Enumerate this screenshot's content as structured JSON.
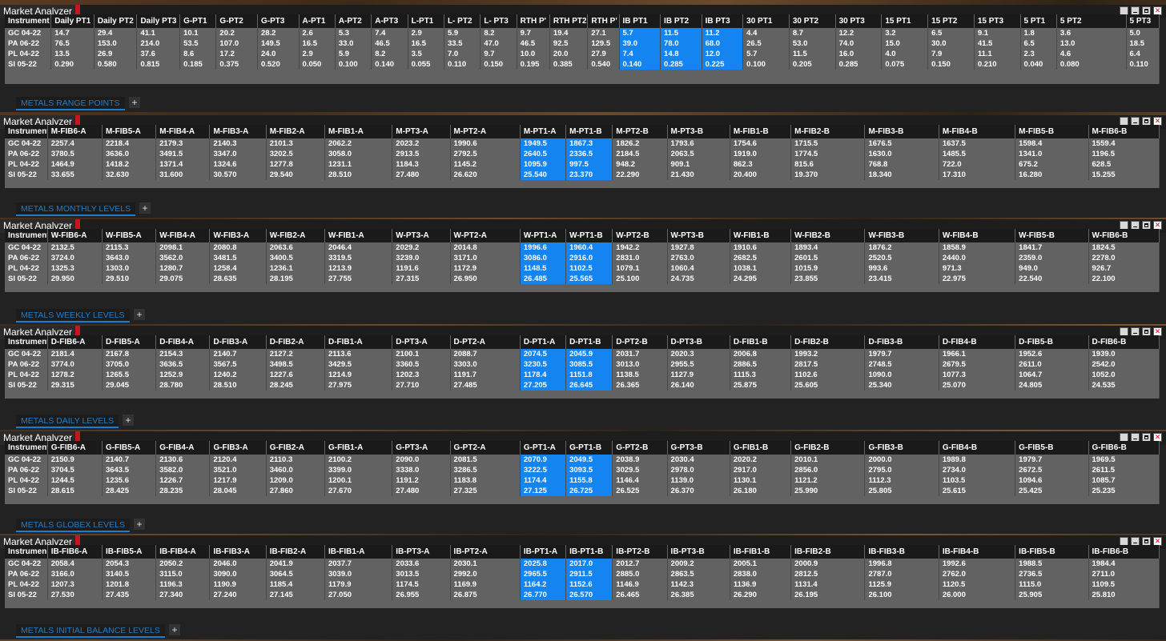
{
  "panels": [
    {
      "title": "Market Analyzer",
      "tab": "METALS RANGE POINTS",
      "columns": [
        "Instrument",
        "Daily PT1",
        "Daily PT2",
        "Daily PT3",
        "G-PT1",
        "G-PT2",
        "G-PT3",
        "A-PT1",
        "A-PT2",
        "A-PT3",
        "L-PT1",
        "L- PT2",
        "L- PT3",
        "RTH P'",
        "RTH PT2",
        "RTH P'",
        "IB PT1",
        "IB PT2",
        "IB PT3",
        "30 PT1",
        "30 PT2",
        "30 PT3",
        "15 PT1",
        "15 PT2",
        "15 PT3",
        "5 PT1",
        "5 PT2",
        "5 PT3"
      ],
      "highlight": [
        16,
        17,
        18
      ],
      "rows": [
        [
          "GC 04-22",
          "14.7",
          "29.4",
          "41.1",
          "10.1",
          "20.2",
          "28.2",
          "2.6",
          "5.3",
          "7.4",
          "2.9",
          "5.9",
          "8.2",
          "9.7",
          "19.4",
          "27.1",
          "5.7",
          "11.5",
          "11.2",
          "4.4",
          "8.7",
          "12.2",
          "3.2",
          "6.5",
          "9.1",
          "1.8",
          "3.6",
          "5.0"
        ],
        [
          "PA 06-22",
          "76.5",
          "153.0",
          "214.0",
          "53.5",
          "107.0",
          "149.5",
          "16.5",
          "33.0",
          "46.5",
          "16.5",
          "33.5",
          "47.0",
          "46.5",
          "92.5",
          "129.5",
          "39.0",
          "78.0",
          "68.0",
          "26.5",
          "53.0",
          "74.0",
          "15.0",
          "30.0",
          "41.5",
          "6.5",
          "13.0",
          "18.5"
        ],
        [
          "PL 04-22",
          "13.5",
          "26.9",
          "37.6",
          "8.6",
          "17.2",
          "24.0",
          "2.9",
          "5.9",
          "8.2",
          "3.5",
          "7.0",
          "9.7",
          "10.0",
          "20.0",
          "27.9",
          "7.4",
          "14.8",
          "12.0",
          "5.7",
          "11.5",
          "16.0",
          "4.0",
          "7.9",
          "11.1",
          "2.3",
          "4.6",
          "6.4"
        ],
        [
          "SI 05-22",
          "0.290",
          "0.580",
          "0.815",
          "0.185",
          "0.375",
          "0.520",
          "0.050",
          "0.100",
          "0.140",
          "0.055",
          "0.110",
          "0.150",
          "0.195",
          "0.385",
          "0.540",
          "0.140",
          "0.285",
          "0.225",
          "0.100",
          "0.205",
          "0.285",
          "0.075",
          "0.150",
          "0.210",
          "0.040",
          "0.080",
          "0.110"
        ]
      ]
    },
    {
      "title": "Market Analyzer",
      "tab": "METALS MONTHLY LEVELS",
      "columns": [
        "Instrument",
        "M-FIB6-A",
        "M-FIB5-A",
        "M-FIB4-A",
        "M-FIB3-A",
        "M-FIB2-A",
        "M-FIB1-A",
        "M-PT3-A",
        "M-PT2-A",
        "M-PT1-A",
        "M-PT1-B",
        "M-PT2-B",
        "M-PT3-B",
        "M-FIB1-B",
        "M-FIB2-B",
        "M-FIB3-B",
        "M-FIB4-B",
        "M-FIB5-B",
        "M-FIB6-B"
      ],
      "highlight": [
        9,
        10
      ],
      "rows": [
        [
          "GC 04-22",
          "2257.4",
          "2218.4",
          "2179.3",
          "2140.3",
          "2101.3",
          "2062.2",
          "2023.2",
          "1990.6",
          "1949.5",
          "1867.3",
          "1826.2",
          "1793.6",
          "1754.6",
          "1715.5",
          "1676.5",
          "1637.5",
          "1598.4",
          "1559.4"
        ],
        [
          "PA 06-22",
          "3780.5",
          "3636.0",
          "3491.5",
          "3347.0",
          "3202.5",
          "3058.0",
          "2913.5",
          "2792.5",
          "2640.5",
          "2336.5",
          "2184.5",
          "2063.5",
          "1919.0",
          "1774.5",
          "1630.0",
          "1485.5",
          "1341.0",
          "1196.5"
        ],
        [
          "PL 04-22",
          "1464.9",
          "1418.2",
          "1371.4",
          "1324.6",
          "1277.8",
          "1231.1",
          "1184.3",
          "1145.2",
          "1095.9",
          "997.5",
          "948.2",
          "909.1",
          "862.3",
          "815.6",
          "768.8",
          "722.0",
          "675.2",
          "628.5"
        ],
        [
          "SI 05-22",
          "33.655",
          "32.630",
          "31.600",
          "30.570",
          "29.540",
          "28.510",
          "27.480",
          "26.620",
          "25.540",
          "23.370",
          "22.290",
          "21.430",
          "20.400",
          "19.370",
          "18.340",
          "17.310",
          "16.280",
          "15.255"
        ]
      ]
    },
    {
      "title": "Market Analyzer",
      "tab": "METALS WEEKLY LEVELS",
      "columns": [
        "Instrument",
        "W-FIB6-A",
        "W-FIB5-A",
        "W-FIB4-A",
        "W-FIB3-A",
        "W-FIB2-A",
        "W-FIB1-A",
        "W-PT3-A",
        "W-PT2-A",
        "W-PT1-A",
        "W-PT1-B",
        "W-PT2-B",
        "W-PT3-B",
        "W-FIB1-B",
        "W-FIB2-B",
        "W-FIB3-B",
        "W-FIB4-B",
        "W-FIB5-B",
        "W-FIB6-B"
      ],
      "highlight": [
        9,
        10
      ],
      "rows": [
        [
          "GC 04-22",
          "2132.5",
          "2115.3",
          "2098.1",
          "2080.8",
          "2063.6",
          "2046.4",
          "2029.2",
          "2014.8",
          "1996.6",
          "1960.4",
          "1942.2",
          "1927.8",
          "1910.6",
          "1893.4",
          "1876.2",
          "1858.9",
          "1841.7",
          "1824.5"
        ],
        [
          "PA 06-22",
          "3724.0",
          "3643.0",
          "3562.0",
          "3481.5",
          "3400.5",
          "3319.5",
          "3239.0",
          "3171.0",
          "3086.0",
          "2916.0",
          "2831.0",
          "2763.0",
          "2682.5",
          "2601.5",
          "2520.5",
          "2440.0",
          "2359.0",
          "2278.0"
        ],
        [
          "PL 04-22",
          "1325.3",
          "1303.0",
          "1280.7",
          "1258.4",
          "1236.1",
          "1213.9",
          "1191.6",
          "1172.9",
          "1148.5",
          "1102.5",
          "1079.1",
          "1060.4",
          "1038.1",
          "1015.9",
          "993.6",
          "971.3",
          "949.0",
          "926.7"
        ],
        [
          "SI 05-22",
          "29.950",
          "29.510",
          "29.075",
          "28.635",
          "28.195",
          "27.755",
          "27.315",
          "26.950",
          "26.485",
          "25.565",
          "25.100",
          "24.735",
          "24.295",
          "23.855",
          "23.415",
          "22.975",
          "22.540",
          "22.100"
        ]
      ]
    },
    {
      "title": "Market Analyzer",
      "tab": "METALS DAILY LEVELS",
      "columns": [
        "Instrument",
        "D-FIB6-A",
        "D-FIB5-A",
        "D-FIB4-A",
        "D-FIB3-A",
        "D-FIB2-A",
        "D-FIB1-A",
        "D-PT3-A",
        "D-PT2-A",
        "D-PT1-A",
        "D-PT1-B",
        "D-PT2-B",
        "D-PT3-B",
        "D-FIB1-B",
        "D-FIB2-B",
        "D-FIB3-B",
        "D-FIB4-B",
        "D-FIB5-B",
        "D-FIB6-B"
      ],
      "highlight": [
        9,
        10
      ],
      "rows": [
        [
          "GC 04-22",
          "2181.4",
          "2167.8",
          "2154.3",
          "2140.7",
          "2127.2",
          "2113.6",
          "2100.1",
          "2088.7",
          "2074.5",
          "2045.9",
          "2031.7",
          "2020.3",
          "2006.8",
          "1993.2",
          "1979.7",
          "1966.1",
          "1952.6",
          "1939.0"
        ],
        [
          "PA 06-22",
          "3774.0",
          "3705.0",
          "3636.5",
          "3567.5",
          "3498.5",
          "3429.5",
          "3360.5",
          "3303.0",
          "3230.5",
          "3085.5",
          "3013.0",
          "2955.5",
          "2886.5",
          "2817.5",
          "2748.5",
          "2679.5",
          "2611.0",
          "2542.0"
        ],
        [
          "PL 04-22",
          "1278.2",
          "1265.5",
          "1252.9",
          "1240.2",
          "1227.6",
          "1214.9",
          "1202.3",
          "1191.7",
          "1178.4",
          "1151.8",
          "1138.5",
          "1127.9",
          "1115.3",
          "1102.6",
          "1090.0",
          "1077.3",
          "1064.7",
          "1052.0"
        ],
        [
          "SI 05-22",
          "29.315",
          "29.045",
          "28.780",
          "28.510",
          "28.245",
          "27.975",
          "27.710",
          "27.485",
          "27.205",
          "26.645",
          "26.365",
          "26.140",
          "25.875",
          "25.605",
          "25.340",
          "25.070",
          "24.805",
          "24.535"
        ]
      ]
    },
    {
      "title": "Market Analyzer",
      "tab": "METALS GLOBEX LEVELS",
      "columns": [
        "Instrument",
        "G-FIB6-A",
        "G-FIB5-A",
        "G-FIB4-A",
        "G-FIB3-A",
        "G-FIB2-A",
        "G-FIB1-A",
        "G-PT3-A",
        "G-PT2-A",
        "G-PT1-A",
        "G-PT1-B",
        "G-PT2-B",
        "G-PT3-B",
        "G-FIB1-B",
        "G-FIB2-B",
        "G-FIB3-B",
        "G-FIB4-B",
        "G-FIB5-B",
        "G-FIB6-B"
      ],
      "highlight": [
        9,
        10
      ],
      "rows": [
        [
          "GC 04-22",
          "2150.9",
          "2140.7",
          "2130.6",
          "2120.4",
          "2110.3",
          "2100.2",
          "2090.0",
          "2081.5",
          "2070.9",
          "2049.5",
          "2038.9",
          "2030.4",
          "2020.2",
          "2010.1",
          "2000.0",
          "1989.8",
          "1979.7",
          "1969.5"
        ],
        [
          "PA 06-22",
          "3704.5",
          "3643.5",
          "3582.0",
          "3521.0",
          "3460.0",
          "3399.0",
          "3338.0",
          "3286.5",
          "3222.5",
          "3093.5",
          "3029.5",
          "2978.0",
          "2917.0",
          "2856.0",
          "2795.0",
          "2734.0",
          "2672.5",
          "2611.5"
        ],
        [
          "PL 04-22",
          "1244.5",
          "1235.6",
          "1226.7",
          "1217.9",
          "1209.0",
          "1200.1",
          "1191.2",
          "1183.8",
          "1174.4",
          "1155.8",
          "1146.4",
          "1139.0",
          "1130.1",
          "1121.2",
          "1112.3",
          "1103.5",
          "1094.6",
          "1085.7"
        ],
        [
          "SI 05-22",
          "28.615",
          "28.425",
          "28.235",
          "28.045",
          "27.860",
          "27.670",
          "27.480",
          "27.325",
          "27.125",
          "26.725",
          "26.525",
          "26.370",
          "26.180",
          "25.990",
          "25.805",
          "25.615",
          "25.425",
          "25.235"
        ]
      ]
    },
    {
      "title": "Market Analyzer",
      "tab": "METALS  INITIAL BALANCE LEVELS",
      "columns": [
        "Instrumen",
        "IB-FIB6-A",
        "IB-FIB5-A",
        "IB-FIB4-A",
        "IB-FIB3-A",
        "IB-FIB2-A",
        "IB-FIB1-A",
        "IB-PT3-A",
        "IB-PT2-A",
        "IB-PT1-A",
        "IB-PT1-B",
        "IB-PT2-B",
        "IB-PT3-B",
        "IB-FIB1-B",
        "IB-FIB2-B",
        "IB-FIB3-B",
        "IB-FIB4-B",
        "IB-FIB5-B",
        "IB-FIB6-B"
      ],
      "highlight": [
        9,
        10
      ],
      "rows": [
        [
          "GC 04-22",
          "2058.4",
          "2054.3",
          "2050.2",
          "2046.0",
          "2041.9",
          "2037.7",
          "2033.6",
          "2030.1",
          "2025.8",
          "2017.0",
          "2012.7",
          "2009.2",
          "2005.1",
          "2000.9",
          "1996.8",
          "1992.6",
          "1988.5",
          "1984.4"
        ],
        [
          "PA 06-22",
          "3166.0",
          "3140.5",
          "3115.0",
          "3090.0",
          "3064.5",
          "3039.0",
          "3013.5",
          "2992.0",
          "2965.5",
          "2911.5",
          "2885.0",
          "2863.5",
          "2838.0",
          "2812.5",
          "2787.0",
          "2762.0",
          "2736.5",
          "2711.0"
        ],
        [
          "PL 04-22",
          "1207.3",
          "1201.8",
          "1196.3",
          "1190.9",
          "1185.4",
          "1179.9",
          "1174.5",
          "1169.9",
          "1164.2",
          "1152.6",
          "1146.9",
          "1142.3",
          "1136.9",
          "1131.4",
          "1125.9",
          "1120.5",
          "1115.0",
          "1109.5"
        ],
        [
          "SI 05-22",
          "27.530",
          "27.435",
          "27.340",
          "27.240",
          "27.145",
          "27.050",
          "26.955",
          "26.875",
          "26.770",
          "26.570",
          "26.465",
          "26.385",
          "26.290",
          "26.195",
          "26.100",
          "26.000",
          "25.905",
          "25.810"
        ]
      ]
    }
  ],
  "plus_label": "+",
  "close_label": "✕"
}
